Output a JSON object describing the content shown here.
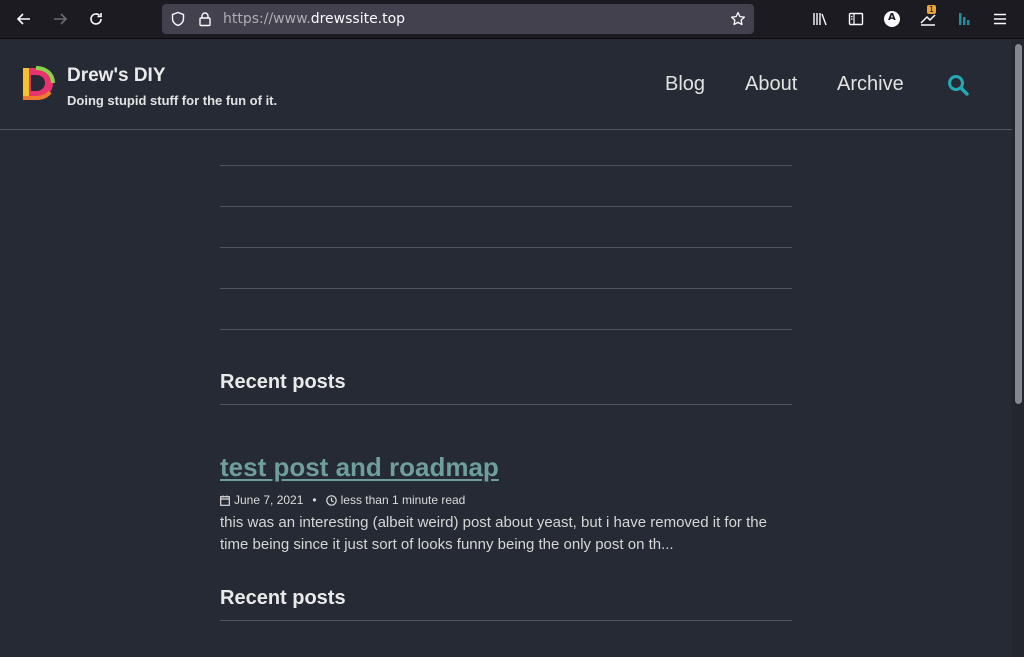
{
  "browser": {
    "url_prefix": "https://www.",
    "url_domain": "drewssite.top",
    "extension_badge": "1",
    "account_initial": "A"
  },
  "site": {
    "title": "Drew's DIY",
    "tagline": "Doing stupid stuff for the fun of it.",
    "nav": [
      {
        "label": "Blog"
      },
      {
        "label": "About"
      },
      {
        "label": "Archive"
      }
    ],
    "accent_color": "#23a9b4"
  },
  "sections": [
    {
      "title": "Recent posts"
    },
    {
      "title": "Recent posts"
    }
  ],
  "post": {
    "title": "test post and roadmap",
    "date": "June 7, 2021",
    "separator": "•",
    "read_time": "less than 1 minute read",
    "excerpt": "this was an interesting (albeit weird) post about yeast, but i have removed it for the time being since it just sort of looks funny being the only post on th..."
  }
}
